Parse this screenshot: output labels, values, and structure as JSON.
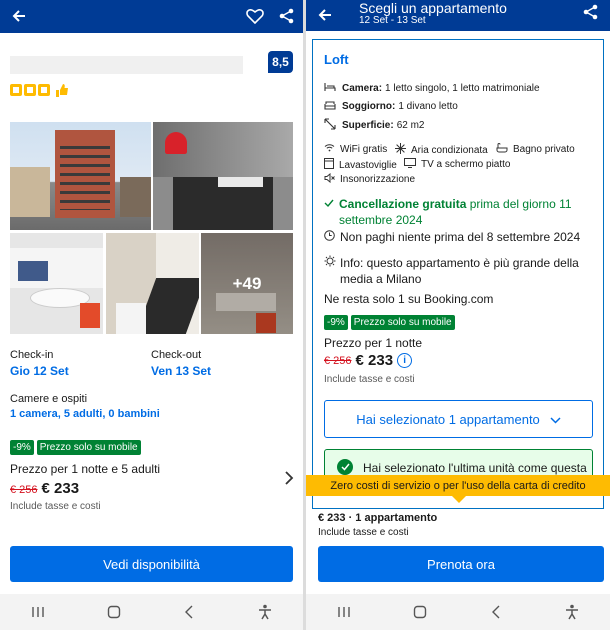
{
  "left": {
    "score": "8,5",
    "checkin": {
      "label": "Check-in",
      "value": "Gio 12 Set"
    },
    "checkout": {
      "label": "Check-out",
      "value": "Ven 13 Set"
    },
    "rooms": {
      "label": "Camere e ospiti",
      "value": "1 camera, 5 adulti, 0 bambini"
    },
    "discount_badge": "-9%",
    "mobile_badge": "Prezzo solo su mobile",
    "price_for": "Prezzo per 1 notte e 5 adulti",
    "old_price": "€ 256",
    "new_price": "€ 233",
    "taxes": "Include tasse e costi",
    "more_photos": "+49",
    "cta": "Vedi disponibilità"
  },
  "right": {
    "title": "Scegli un appartamento",
    "dates": "12 Set - 13 Set",
    "room_name": "Loft",
    "beds_label": "Camera:",
    "beds_value": "1 letto singolo, 1 letto matrimoniale",
    "living_label": "Soggiorno:",
    "living_value": "1 divano letto",
    "area_label": "Superficie:",
    "area_value": "62 m2",
    "facilities": [
      "WiFi gratis",
      "Aria condizionata",
      "Bagno privato",
      "Lavastoviglie",
      "TV a schermo piatto",
      "Insonorizzazione"
    ],
    "cancel_bold": "Cancellazione gratuita",
    "cancel_rest": "prima del giorno 11 settembre 2024",
    "no_prepay": "Non paghi niente prima del 8 settembre 2024",
    "info": "Info: questo appartamento è più grande della media a Milano",
    "left_only": "Ne resta solo 1 su Booking.com",
    "discount_badge": "-9%",
    "mobile_badge": "Prezzo solo su mobile",
    "price_for": "Prezzo per 1 notte",
    "old_price": "€ 256",
    "new_price": "€ 233",
    "taxes": "Include tasse e costi",
    "selected_btn": "Hai selezionato 1 appartamento",
    "last_unit": "Hai selezionato l'ultima unità come questa",
    "tooltip": "Zero costi di servizio o per l'uso della carta di credito",
    "summary": "€ 233 · 1 appartamento",
    "summary_taxes": "Include tasse e costi",
    "cta": "Prenota ora"
  },
  "colors": {
    "brand_blue": "#003b95",
    "link_blue": "#006ce4",
    "green": "#008234",
    "yellow": "#febb02",
    "score_bg": "#003b95"
  }
}
